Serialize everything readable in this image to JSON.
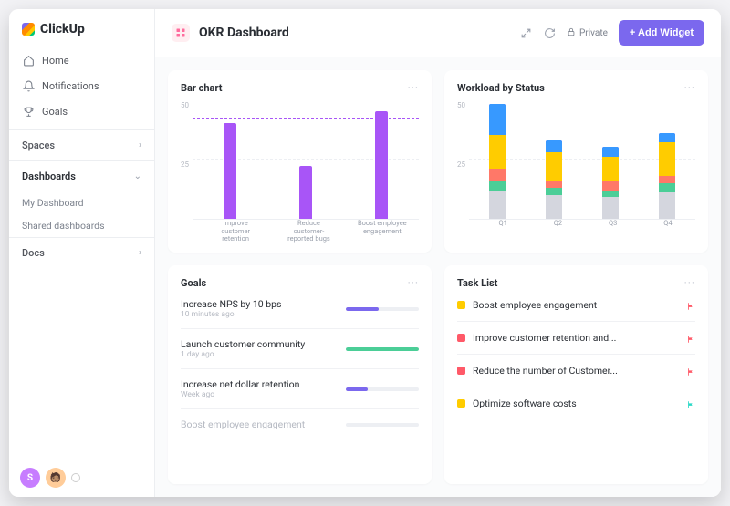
{
  "brand": {
    "name": "ClickUp"
  },
  "sidebar": {
    "nav": [
      {
        "label": "Home",
        "icon": "home"
      },
      {
        "label": "Notifications",
        "icon": "bell"
      },
      {
        "label": "Goals",
        "icon": "trophy"
      }
    ],
    "spaces_label": "Spaces",
    "dashboards_label": "Dashboards",
    "dashboards_children": [
      {
        "label": "My Dashboard"
      },
      {
        "label": "Shared dashboards"
      }
    ],
    "docs_label": "Docs",
    "avatar_letter": "S"
  },
  "header": {
    "title": "OKR Dashboard",
    "private_label": "Private",
    "add_widget_label": "+ Add Widget"
  },
  "cards": {
    "bar": {
      "title": "Bar chart"
    },
    "workload": {
      "title": "Workload by Status"
    },
    "goals": {
      "title": "Goals"
    },
    "tasks": {
      "title": "Task List"
    }
  },
  "chart_data": [
    {
      "id": "bar",
      "type": "bar",
      "title": "Bar chart",
      "categories": [
        "Improve customer retention",
        "Reduce customer-reported bugs",
        "Boost employee engagement"
      ],
      "values": [
        40,
        22,
        45
      ],
      "target_line": 42,
      "ylabel": "",
      "ylim": [
        0,
        50
      ],
      "yticks": [
        50,
        25,
        0
      ],
      "bar_color": "#a855f7"
    },
    {
      "id": "workload",
      "type": "stacked_bar",
      "title": "Workload by Status",
      "categories": [
        "Q1",
        "Q2",
        "Q3",
        "Q4"
      ],
      "series": [
        {
          "name": "Grey",
          "color": "#d4d6de",
          "values": [
            12,
            10,
            9,
            11
          ]
        },
        {
          "name": "Green",
          "color": "#4bce97",
          "values": [
            4,
            3,
            3,
            4
          ]
        },
        {
          "name": "Red",
          "color": "#ff7868",
          "values": [
            5,
            3,
            4,
            3
          ]
        },
        {
          "name": "Yellow",
          "color": "#ffcc00",
          "values": [
            14,
            12,
            10,
            14
          ]
        },
        {
          "name": "Blue",
          "color": "#3799ff",
          "values": [
            13,
            5,
            4,
            4
          ]
        }
      ],
      "ylim": [
        0,
        50
      ],
      "yticks": [
        50,
        25,
        0
      ]
    }
  ],
  "goals": [
    {
      "text": "Increase NPS by 10 bps",
      "sub": "10 minutes ago",
      "progress": 45,
      "color": "#7b68ee"
    },
    {
      "text": "Launch customer community",
      "sub": "1 day ago",
      "progress": 100,
      "color": "#4bce97"
    },
    {
      "text": "Increase net dollar retention",
      "sub": "Week ago",
      "progress": 30,
      "color": "#7b68ee"
    },
    {
      "text": "Boost employee engagement",
      "sub": "",
      "progress": 0,
      "color": "#c5c9d2",
      "faded": true
    }
  ],
  "tasks": [
    {
      "text": "Boost employee engagement",
      "sq": "#ffcc00",
      "flag": "#ff5968"
    },
    {
      "text": "Improve customer retention and...",
      "sq": "#ff5968",
      "flag": "#ff5968"
    },
    {
      "text": "Reduce the number of Customer...",
      "sq": "#ff5968",
      "flag": "#ff5968"
    },
    {
      "text": "Optimize software costs",
      "sq": "#ffcc00",
      "flag": "#2bd9c7"
    }
  ]
}
